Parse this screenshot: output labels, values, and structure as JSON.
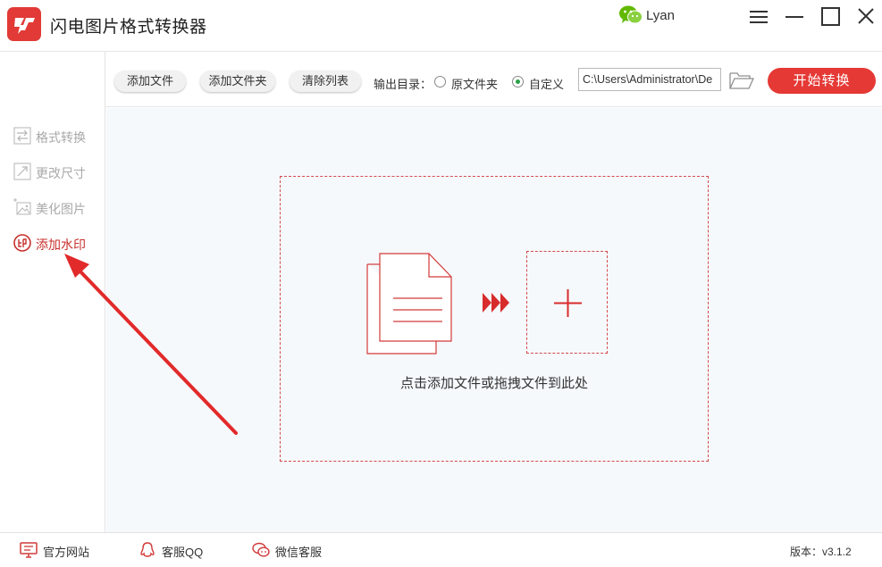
{
  "app": {
    "title": "闪电图片格式转换器"
  },
  "user": {
    "name": "Lyan"
  },
  "sidebar": {
    "items": [
      {
        "label": "格式转换",
        "icon": "swap-arrows-icon",
        "active": false
      },
      {
        "label": "更改尺寸",
        "icon": "resize-icon",
        "active": false
      },
      {
        "label": "美化图片",
        "icon": "image-sparkle-icon",
        "active": false
      },
      {
        "label": "添加水印",
        "icon": "stamp-seal-icon",
        "active": true
      }
    ]
  },
  "toolbar": {
    "add_file": "添加文件",
    "add_folder": "添加文件夹",
    "clear_list": "清除列表",
    "output_label": "输出目录：",
    "option_original": "原文件夹",
    "option_custom": "自定义",
    "selected_option": "自定义",
    "output_path": "C:\\Users\\Administrator\\De",
    "start": "开始转换"
  },
  "main": {
    "drop_hint": "点击添加文件或拖拽文件到此处"
  },
  "footer": {
    "website": "官方网站",
    "qq_service": "客服QQ",
    "wechat_service": "微信客服",
    "version": "版本：v3.1.2"
  },
  "colors": {
    "accent": "#e53935",
    "active_text": "#c8302c",
    "radio_check": "#2aa14b",
    "main_bg": "#f6f9fc"
  }
}
